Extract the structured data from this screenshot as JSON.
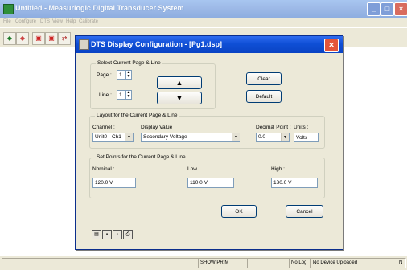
{
  "window": {
    "title": "Untitled - Measurlogic Digital Transducer System"
  },
  "menu": [
    {
      "label": "File"
    },
    {
      "label": "Configure"
    },
    {
      "label": "DTS"
    },
    {
      "label": "View"
    },
    {
      "label": "Help"
    },
    {
      "label": "Calibrate"
    }
  ],
  "status": {
    "mode": "SHOW PRIM",
    "log": "No Log",
    "device": "No Device Uploaded",
    "num": "N"
  },
  "dialog": {
    "title": "DTS Display Configuration - [Pg1.dsp]",
    "select_group": {
      "legend": "Select Current Page & Line",
      "page_label": "Page :",
      "page_value": "1",
      "line_label": "Line :",
      "line_value": "1",
      "clear_label": "Clear",
      "default_label": "Default"
    },
    "layout_group": {
      "legend": "Layout for the Current Page & Line",
      "channel_label": "Channel :",
      "channel_value": "Unit0 - Ch1",
      "display_label": "Display Value",
      "display_value": "Secondary Voltage",
      "decimal_label": "Decimal Point :",
      "decimal_value": "0.0",
      "units_label": "Units :",
      "units_value": "Volts"
    },
    "setpoints_group": {
      "legend": "Set Points for the Current Page & Line",
      "nominal_label": "Nominal :",
      "nominal_value": "120.0 V",
      "low_label": "Low :",
      "low_value": "110.0 V",
      "high_label": "High :",
      "high_value": "130.0 V"
    },
    "ok_label": "OK",
    "cancel_label": "Cancel"
  }
}
